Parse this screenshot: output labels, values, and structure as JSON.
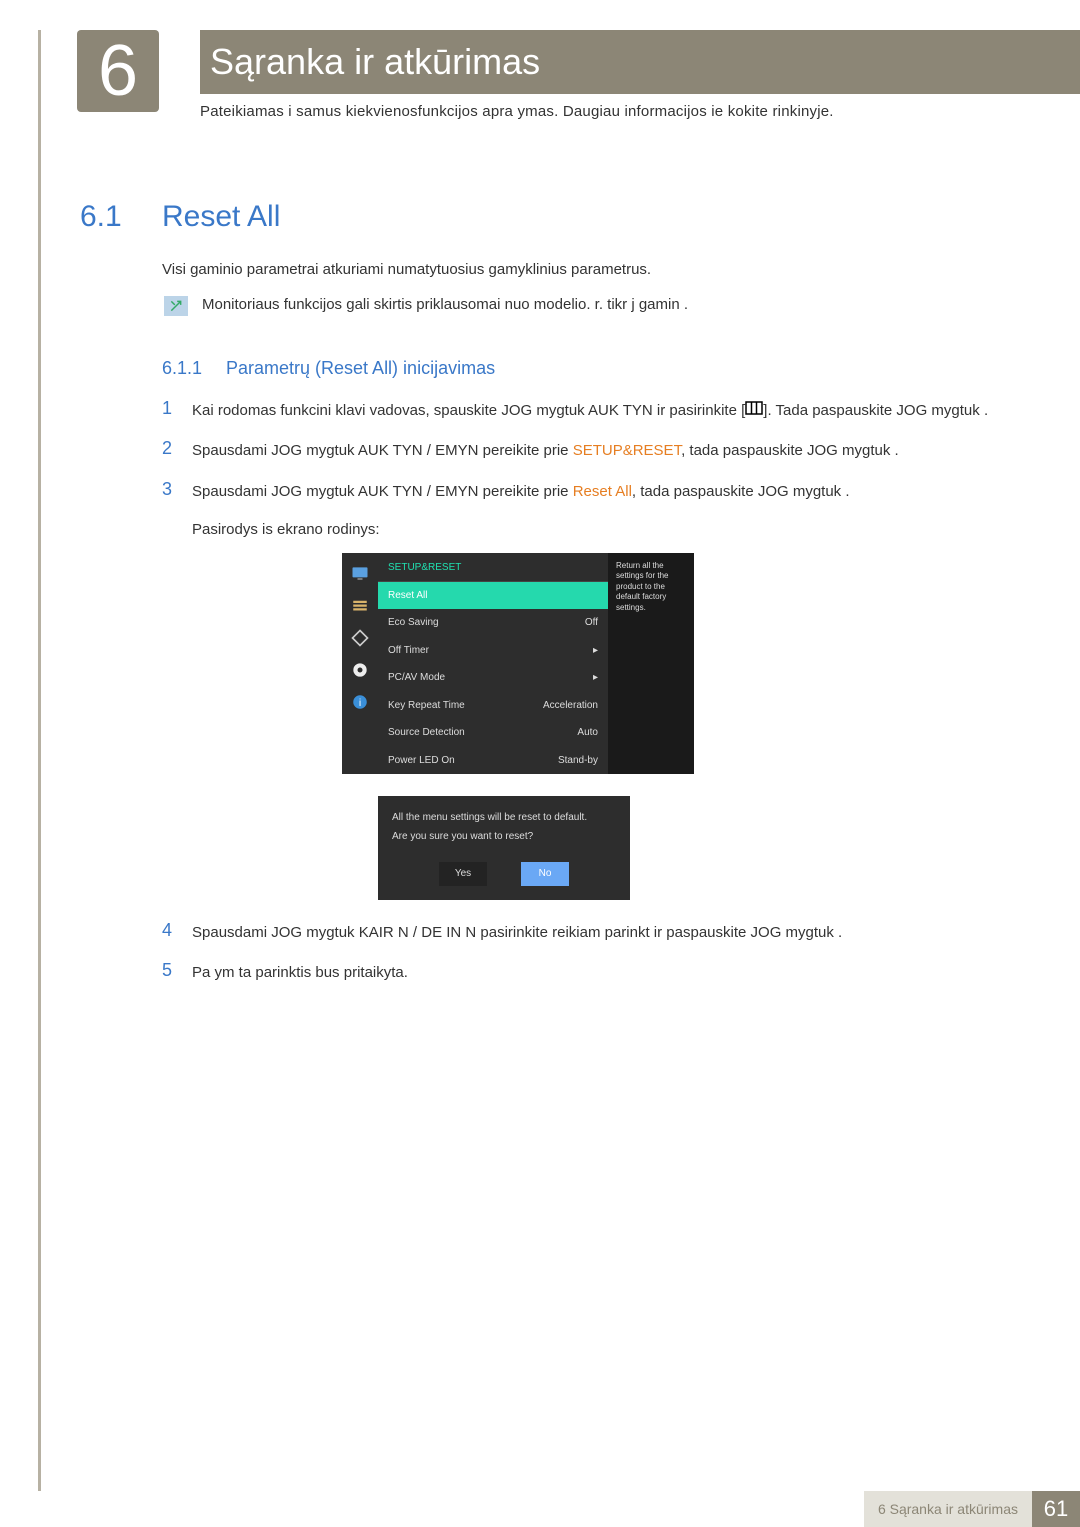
{
  "chapter": {
    "number": "6",
    "title": "Sąranka ir atkūrimas",
    "subtitle": "Pateikiamas i samus kiekvienosfunkcijos apra ymas. Daugiau informacijos ie kokite rinkinyje."
  },
  "section": {
    "number": "6.1",
    "title": "Reset All",
    "p1": "Visi gaminio parametrai atkuriami  numatytuosius gamyklinius parametrus.",
    "info": "Monitoriaus funkcijos gali skirtis priklausomai nuo modelio.  r. tikr j  gamin ."
  },
  "subsection": {
    "number": "6.1.1",
    "title": "Parametrų (Reset All) inicijavimas"
  },
  "steps": {
    "s1a": "Kai rodomas funkcini  klavi   vadovas, spauskite JOG mygtuk  AUK TYN ir pasirinkite [",
    "s1b": "]. Tada paspauskite JOG mygtuk .",
    "s2a": "Spausdami JOG mygtuk  AUK TYN /  EMYN pereikite prie ",
    "s2hl": "SETUP&RESET",
    "s2b": ", tada paspauskite JOG mygtuk .",
    "s3a": "Spausdami JOG mygtuk  AUK TYN /  EMYN pereikite prie ",
    "s3hl": "Reset All",
    "s3b": ", tada paspauskite JOG mygtuk .",
    "s3c": "Pasirodys  is ekrano rodinys:",
    "s4": "Spausdami JOG mygtuk  KAIR N / DE IN N pasirinkite reikiam  parinkt  ir paspauskite JOG mygtuk .",
    "s5": "Pa ym ta parinktis bus pritaikyta."
  },
  "osd": {
    "header": "SETUP&RESET",
    "rows": [
      {
        "label": "Reset All",
        "value": ""
      },
      {
        "label": "Eco Saving",
        "value": "Off"
      },
      {
        "label": "Off Timer",
        "value": "▸"
      },
      {
        "label": "PC/AV Mode",
        "value": "▸"
      },
      {
        "label": "Key Repeat Time",
        "value": "Acceleration"
      },
      {
        "label": "Source Detection",
        "value": "Auto"
      },
      {
        "label": "Power LED On",
        "value": "Stand-by"
      }
    ],
    "description": "Return all the settings for the product to the default factory settings.",
    "dialog": {
      "line1": "All the menu settings will be reset to default.",
      "line2": "Are you sure you want to reset?",
      "yes": "Yes",
      "no": "No"
    }
  },
  "footer": {
    "label": "6 Sąranka ir atkūrimas",
    "page": "61"
  }
}
